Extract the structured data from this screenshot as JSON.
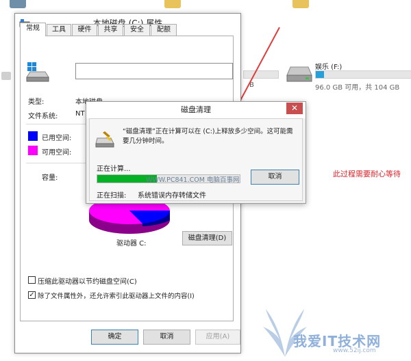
{
  "background": {
    "drive": {
      "label": "娱乐 (F:)",
      "free_text": "96.0 GB 可用，共 104 GB",
      "used_fraction": 0.08
    },
    "left_drive_partial_text": "B",
    "colors": {
      "drive_fill": "#26a0da"
    }
  },
  "properties": {
    "title": "本地磁盘 (C:) 属性",
    "tabs": [
      "常规",
      "工具",
      "硬件",
      "共享",
      "安全",
      "配额"
    ],
    "active_tab": "常规",
    "name_value": "",
    "type_label": "类型:",
    "type_value": "本地磁盘",
    "fs_label": "文件系统:",
    "fs_value_partial": "NT",
    "used_label": "已用空间:",
    "free_label": "可用空间:",
    "capacity_label": "容量:",
    "drive_label": "驱动器 C:",
    "cleanup_button": "磁盘清理(D)",
    "compress_option": {
      "label": "压缩此驱动器以节约磁盘空间(C)",
      "checked": false
    },
    "index_option": {
      "label": "除了文件属性外，还允许索引此驱动器上文件的内容(I)",
      "checked": true
    },
    "ok_button": "确定",
    "cancel_button": "取消",
    "apply_button": "应用(A)",
    "colors": {
      "used": "#0000ff",
      "free": "#ff00ff"
    }
  },
  "disk_cleanup": {
    "title": "磁盘清理",
    "message": "“磁盘清理”正在计算可以在 (C:)上释放多少空间。这可能需要几分钟时间。",
    "calculating_label": "正在计算...",
    "cancel_button": "取消",
    "scanning_label": "正在扫描:",
    "scanning_value": "系统错误内存转储文件",
    "progress_fraction": 0.42,
    "watermark": "WWW.PC841.COM 电脑百事网",
    "colors": {
      "progress": "#06b025",
      "close": "#c74f4f"
    }
  },
  "annotation": {
    "text": "此过程需要耐心等待"
  },
  "site_logo": {
    "text": "我爱IT技术网",
    "url_text": "www.52ij.com"
  }
}
